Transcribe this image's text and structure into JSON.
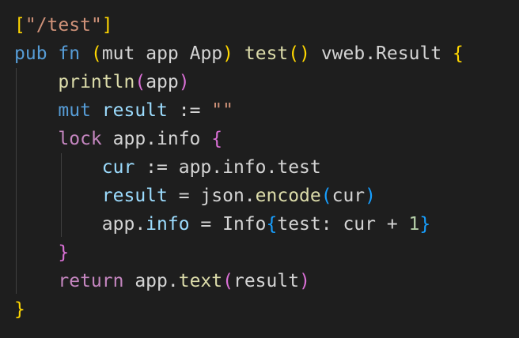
{
  "code": {
    "language": "v",
    "lines": [
      {
        "indent": "",
        "tokens": [
          {
            "t": "[",
            "c": "b1"
          },
          {
            "t": "\"/test\"",
            "c": "str"
          },
          {
            "t": "]",
            "c": "b1"
          }
        ]
      },
      {
        "indent": "",
        "tokens": [
          {
            "t": "pub",
            "c": "kw"
          },
          {
            "t": " ",
            "c": "plain"
          },
          {
            "t": "fn",
            "c": "kw"
          },
          {
            "t": " ",
            "c": "plain"
          },
          {
            "t": "(",
            "c": "b1"
          },
          {
            "t": "mut",
            "c": "plain"
          },
          {
            "t": " app App",
            "c": "plain"
          },
          {
            "t": ")",
            "c": "b1"
          },
          {
            "t": " ",
            "c": "plain"
          },
          {
            "t": "test",
            "c": "fn"
          },
          {
            "t": "()",
            "c": "b1"
          },
          {
            "t": " vweb.Result ",
            "c": "plain"
          },
          {
            "t": "{",
            "c": "b1"
          }
        ]
      },
      {
        "indent": "    ",
        "tokens": [
          {
            "t": "println",
            "c": "fn"
          },
          {
            "t": "(",
            "c": "b2"
          },
          {
            "t": "app",
            "c": "plain"
          },
          {
            "t": ")",
            "c": "b2"
          }
        ]
      },
      {
        "indent": "    ",
        "tokens": [
          {
            "t": "mut",
            "c": "kw"
          },
          {
            "t": " ",
            "c": "plain"
          },
          {
            "t": "result",
            "c": "var"
          },
          {
            "t": " := ",
            "c": "plain"
          },
          {
            "t": "\"\"",
            "c": "str"
          }
        ]
      },
      {
        "indent": "    ",
        "tokens": [
          {
            "t": "lock",
            "c": "ctrl"
          },
          {
            "t": " app.info ",
            "c": "plain"
          },
          {
            "t": "{",
            "c": "b2"
          }
        ]
      },
      {
        "indent": "        ",
        "tokens": [
          {
            "t": "cur",
            "c": "var"
          },
          {
            "t": " := app.info.test",
            "c": "plain"
          }
        ]
      },
      {
        "indent": "        ",
        "tokens": [
          {
            "t": "result",
            "c": "var"
          },
          {
            "t": " = json.",
            "c": "plain"
          },
          {
            "t": "encode",
            "c": "fn"
          },
          {
            "t": "(",
            "c": "b3"
          },
          {
            "t": "cur",
            "c": "plain"
          },
          {
            "t": ")",
            "c": "b3"
          }
        ]
      },
      {
        "indent": "        ",
        "tokens": [
          {
            "t": "app.",
            "c": "plain"
          },
          {
            "t": "info",
            "c": "var"
          },
          {
            "t": " = Info",
            "c": "plain"
          },
          {
            "t": "{",
            "c": "b3"
          },
          {
            "t": "test: cur + ",
            "c": "plain"
          },
          {
            "t": "1",
            "c": "num"
          },
          {
            "t": "}",
            "c": "b3"
          }
        ]
      },
      {
        "indent": "    ",
        "tokens": [
          {
            "t": "}",
            "c": "b2"
          }
        ]
      },
      {
        "indent": "    ",
        "tokens": [
          {
            "t": "return",
            "c": "ctrl"
          },
          {
            "t": " app.",
            "c": "plain"
          },
          {
            "t": "text",
            "c": "fn"
          },
          {
            "t": "(",
            "c": "b2"
          },
          {
            "t": "result",
            "c": "plain"
          },
          {
            "t": ")",
            "c": "b2"
          }
        ]
      },
      {
        "indent": "",
        "tokens": [
          {
            "t": "}",
            "c": "b1"
          }
        ]
      }
    ]
  },
  "colors": {
    "background": "#1e1e1e",
    "plain": "#d4d4d4",
    "keyword": "#569cd6",
    "control": "#c586c0",
    "function": "#dcdcaa",
    "variable": "#9cdcfe",
    "string": "#ce9178",
    "number": "#b5cea8",
    "bracket_1": "#ffd700",
    "bracket_2": "#da70d6",
    "bracket_3": "#179fff",
    "indent_guide": "#404040"
  }
}
